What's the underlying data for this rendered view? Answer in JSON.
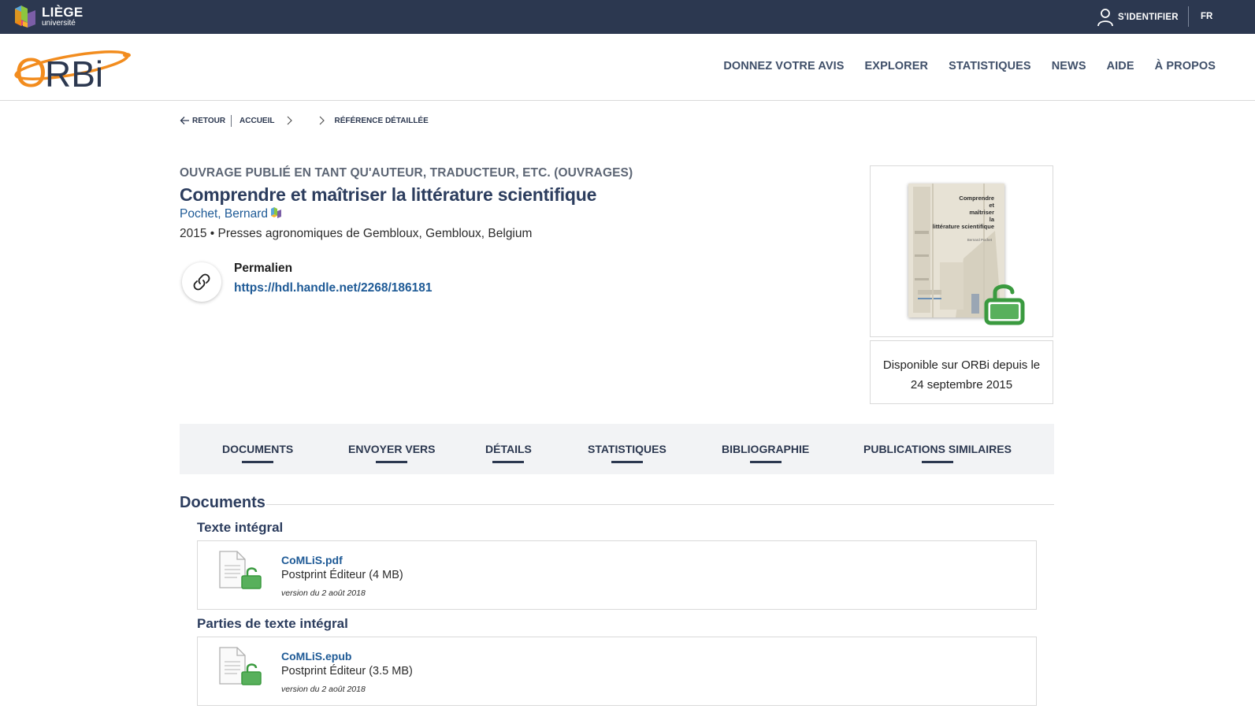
{
  "topbar": {
    "university_name": "LIÈGE",
    "university_sub": "université",
    "login_label": "S'IDENTIFIER",
    "language": "FR"
  },
  "header": {
    "logo_text": "ORBi",
    "nav": [
      {
        "label": "DONNEZ VOTRE AVIS"
      },
      {
        "label": "EXPLORER"
      },
      {
        "label": "STATISTIQUES"
      },
      {
        "label": "NEWS"
      },
      {
        "label": "AIDE"
      },
      {
        "label": "À PROPOS"
      }
    ]
  },
  "breadcrumb": {
    "back": "RETOUR",
    "home": "ACCUEIL",
    "current": "RÉFÉRENCE DÉTAILLÉE"
  },
  "record": {
    "type": "OUVRAGE PUBLIÉ EN TANT QU'AUTEUR, TRADUCTEUR, ETC. (OUVRAGES)",
    "title": "Comprendre et maîtriser la littérature scientifique",
    "author": "Pochet, Bernard",
    "publication": "2015 • Presses agronomiques de Gembloux, Gembloux, Belgium",
    "permalink_label": "Permalien",
    "permalink_url": "https://hdl.handle.net/2268/186181"
  },
  "cover": {
    "title_lines": [
      "Comprendre",
      "et",
      "maîtriser",
      "la",
      "littérature scientifique"
    ],
    "author": "Bernard Pochet",
    "available_line1": "Disponible sur ORBi depuis le",
    "available_line2": "24 septembre 2015"
  },
  "tabs": [
    {
      "label": "DOCUMENTS"
    },
    {
      "label": "ENVOYER VERS"
    },
    {
      "label": "DÉTAILS"
    },
    {
      "label": "STATISTIQUES"
    },
    {
      "label": "BIBLIOGRAPHIE"
    },
    {
      "label": "PUBLICATIONS SIMILAIRES"
    }
  ],
  "documents": {
    "section_title": "Documents",
    "groups": [
      {
        "title": "Texte intégral",
        "file": {
          "name": "CoMLiS.pdf",
          "type": "Postprint Éditeur (4 MB)",
          "version": "version du 2 août 2018"
        }
      },
      {
        "title": "Parties de texte intégral",
        "file": {
          "name": "CoMLiS.epub",
          "type": "Postprint Éditeur (3.5 MB)",
          "version": "version du 2 août 2018"
        }
      }
    ]
  },
  "colors": {
    "topbar_bg": "#2c3850",
    "title_blue": "#2c3d5e",
    "link_blue": "#1e5a96",
    "orbi_orange": "#f28c1e",
    "open_access_green": "#3a9a3f"
  }
}
